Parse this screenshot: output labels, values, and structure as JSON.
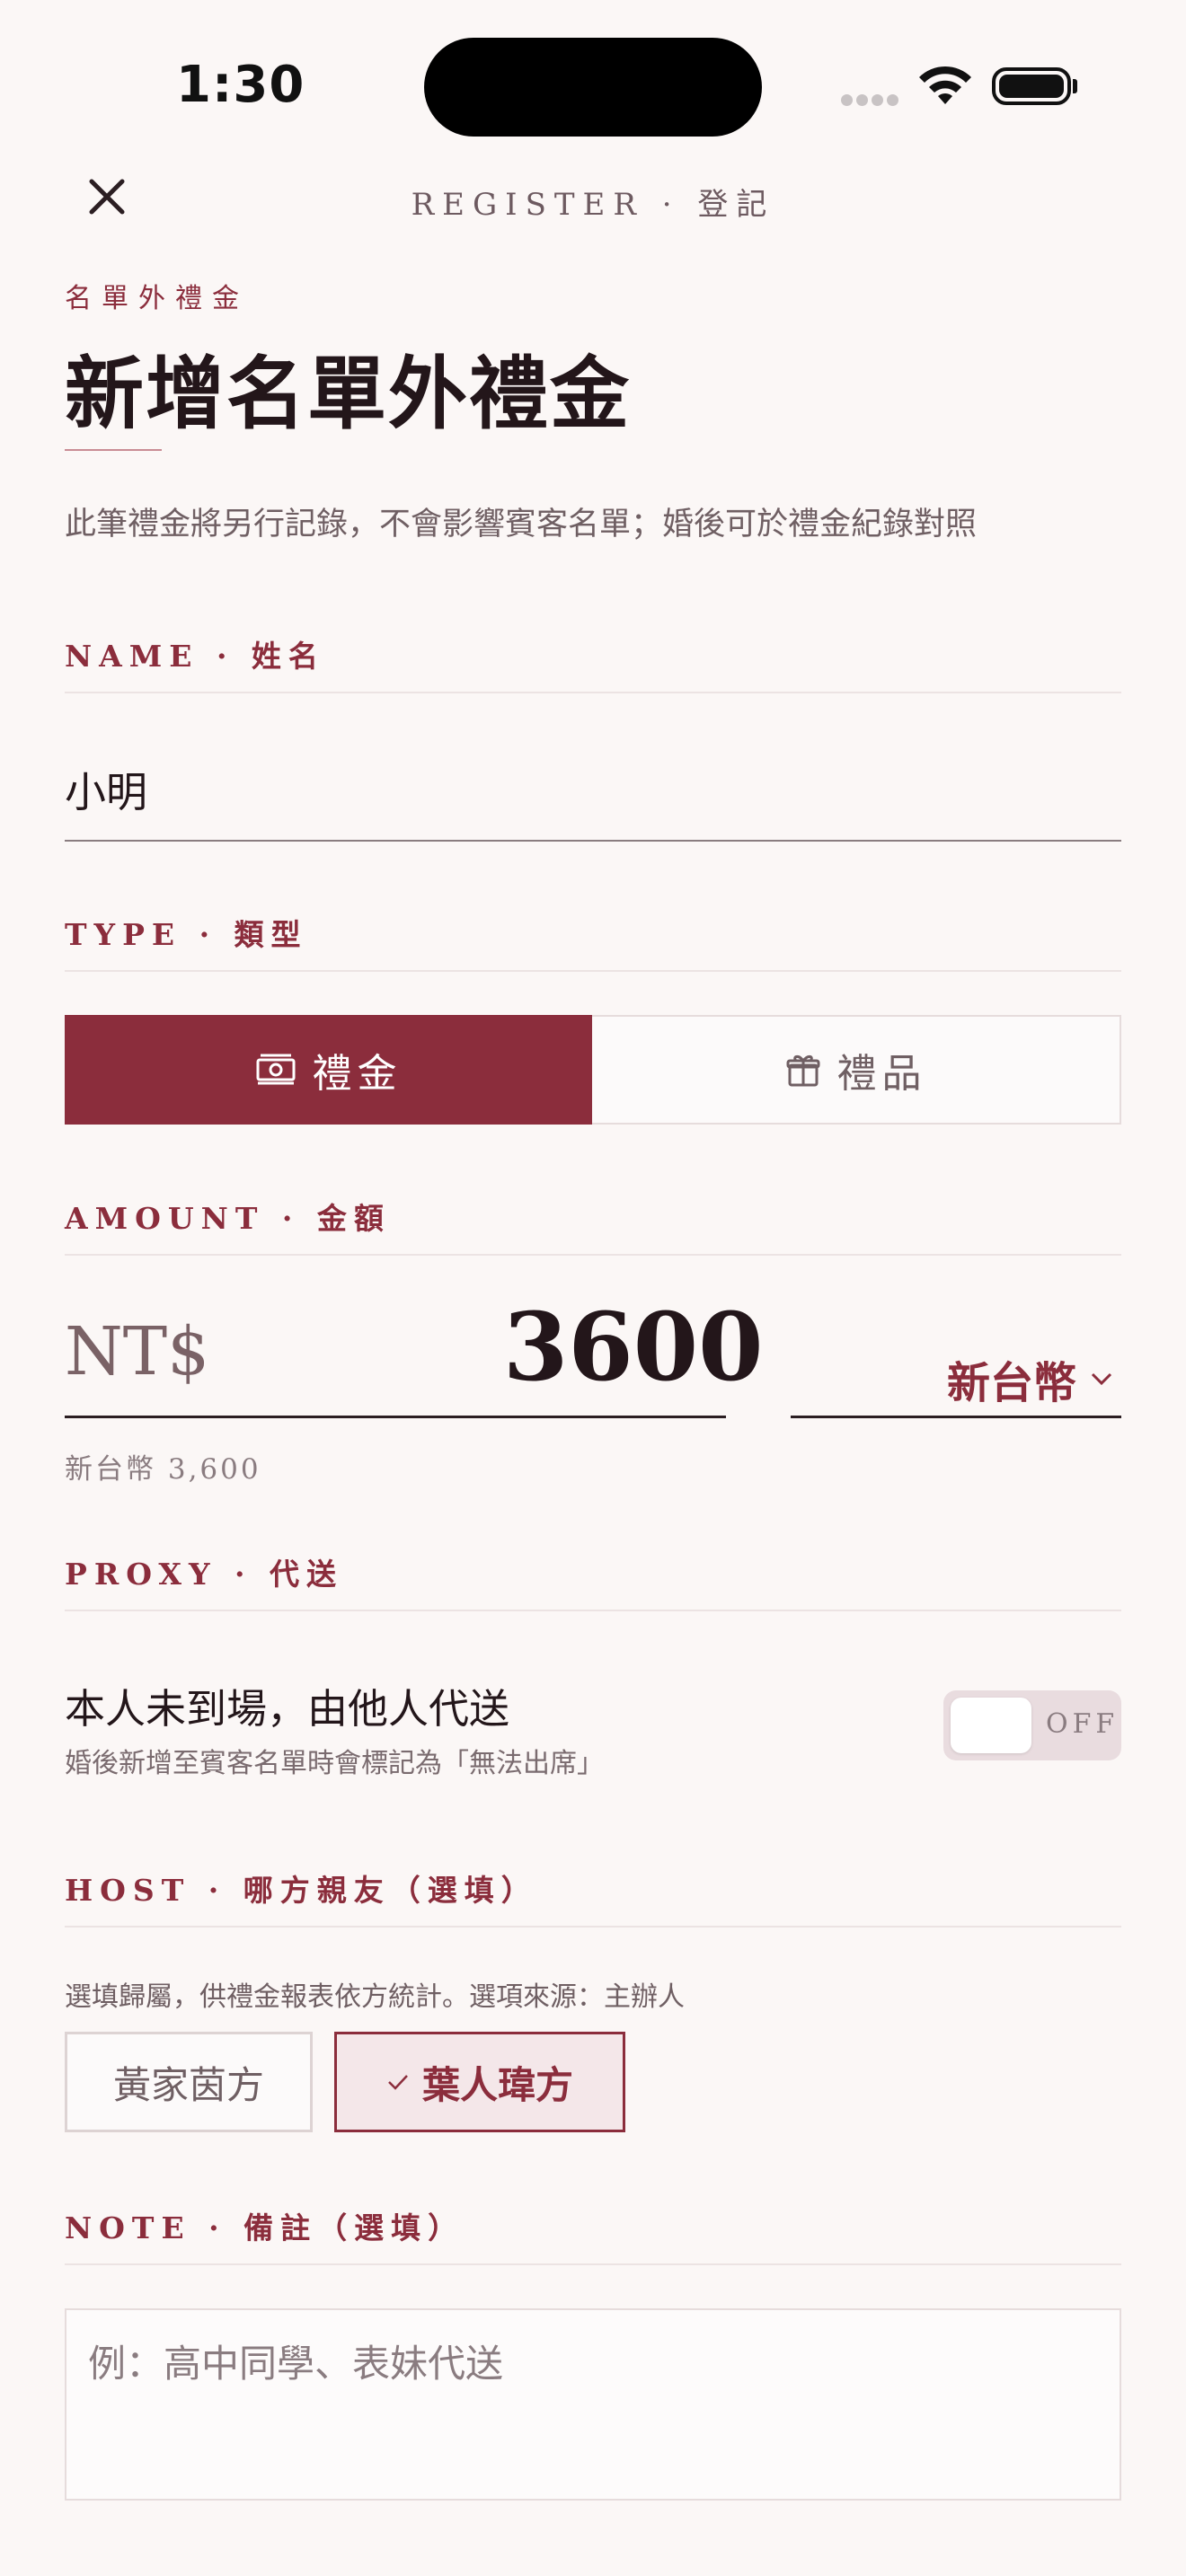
{
  "status_bar": {
    "time": "1:30"
  },
  "header": {
    "title": "REGISTER · 登記"
  },
  "page": {
    "eyebrow": "名單外禮金",
    "title": "新增名單外禮金",
    "description": "此筆禮金將另行記錄，不會影響賓客名單；婚後可於禮金紀錄對照"
  },
  "name_section": {
    "label": "NAME · 姓名",
    "value": "小明"
  },
  "type_section": {
    "label": "TYPE · 類型",
    "options": [
      {
        "label": "禮金",
        "icon": "banknote-icon",
        "selected": true
      },
      {
        "label": "禮品",
        "icon": "gift-icon",
        "selected": false
      }
    ]
  },
  "amount_section": {
    "label": "AMOUNT · 金額",
    "currency_prefix": "NT$",
    "value": "3600",
    "currency_select": "新台幣",
    "helper": "新台幣 3,600"
  },
  "proxy_section": {
    "label": "PROXY · 代送",
    "title": "本人未到場，由他人代送",
    "subtitle": "婚後新增至賓客名單時會標記為「無法出席」",
    "toggle_state": "OFF"
  },
  "host_section": {
    "label": "HOST · 哪方親友（選填）",
    "hint": "選填歸屬，供禮金報表依方統計。選項來源：主辦人",
    "options": [
      {
        "label": "黃家茵方",
        "selected": false
      },
      {
        "label": "葉人瑋方",
        "selected": true
      }
    ]
  },
  "note_section": {
    "label": "NOTE · 備註（選填）",
    "placeholder": "例：高中同學、表妹代送"
  },
  "colors": {
    "accent": "#8b2d3c",
    "background": "#fbf7f6",
    "text": "#23161a"
  }
}
